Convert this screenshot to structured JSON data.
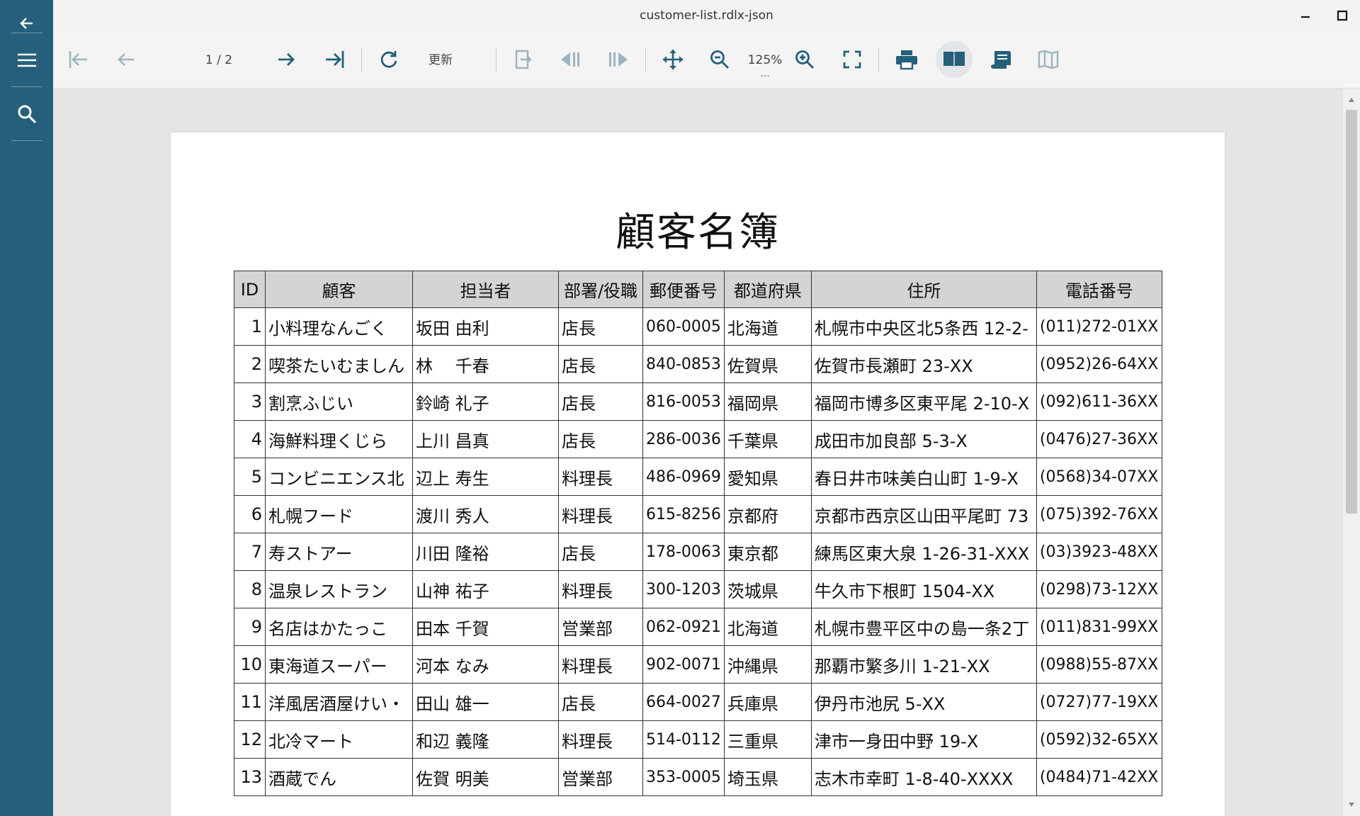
{
  "window": {
    "title": "customer-list.rdlx-json"
  },
  "toolbar": {
    "page_indicator": "1 / 2",
    "refresh_label": "更新",
    "zoom_level": "125%",
    "zoom_more": "..."
  },
  "report": {
    "title": "顧客名簿",
    "columns": [
      "ID",
      "顧客",
      "担当者",
      "部署/役職",
      "郵便番号",
      "都道府県",
      "住所",
      "電話番号"
    ],
    "rows": [
      [
        "1",
        "小料理なんごく",
        "坂田 由利",
        "店長",
        "060-0005",
        "北海道",
        "札幌市中央区北5条西 12-2-",
        "(011)272-01XX"
      ],
      [
        "2",
        "喫茶たいむましん",
        "林　 千春",
        "店長",
        "840-0853",
        "佐賀県",
        "佐賀市長瀬町 23-XX",
        "(0952)26-64XX"
      ],
      [
        "3",
        "割烹ふじい",
        "鈴崎 礼子",
        "店長",
        "816-0053",
        "福岡県",
        "福岡市博多区東平尾 2-10-X",
        "(092)611-36XX"
      ],
      [
        "4",
        "海鮮料理くじら",
        "上川 昌真",
        "店長",
        "286-0036",
        "千葉県",
        "成田市加良部 5-3-X",
        "(0476)27-36XX"
      ],
      [
        "5",
        "コンビニエンス北",
        "辺上 寿生",
        "料理長",
        "486-0969",
        "愛知県",
        "春日井市味美白山町 1-9-X",
        "(0568)34-07XX"
      ],
      [
        "6",
        "札幌フード",
        "渡川 秀人",
        "料理長",
        "615-8256",
        "京都府",
        "京都市西京区山田平尾町 73",
        "(075)392-76XX"
      ],
      [
        "7",
        "寿ストアー",
        "川田 隆裕",
        "店長",
        "178-0063",
        "東京都",
        "練馬区東大泉 1-26-31-XXX",
        "(03)3923-48XX"
      ],
      [
        "8",
        "温泉レストラン",
        "山神 祐子",
        "料理長",
        "300-1203",
        "茨城県",
        "牛久市下根町 1504-XX",
        "(0298)73-12XX"
      ],
      [
        "9",
        "名店はかたっこ",
        "田本 千賀",
        "営業部",
        "062-0921",
        "北海道",
        "札幌市豊平区中の島一条2丁",
        "(011)831-99XX"
      ],
      [
        "10",
        "東海道スーパー",
        "河本 なみ",
        "料理長",
        "902-0071",
        "沖縄県",
        "那覇市繁多川 1-21-XX",
        "(0988)55-87XX"
      ],
      [
        "11",
        "洋風居酒屋けい・",
        "田山 雄一",
        "店長",
        "664-0027",
        "兵庫県",
        "伊丹市池尻 5-XX",
        "(0727)77-19XX"
      ],
      [
        "12",
        "北冷マート",
        "和辺 義隆",
        "料理長",
        "514-0112",
        "三重県",
        "津市一身田中野 19-X",
        "(0592)32-65XX"
      ],
      [
        "13",
        "酒蔵でん",
        "佐賀 明美",
        "営業部",
        "353-0005",
        "埼玉県",
        "志木市幸町 1-8-40-XXXX",
        "(0484)71-42XX"
      ]
    ]
  },
  "colors": {
    "rail": "#255f7b",
    "toolbar_bg": "#f4f4f4",
    "icon_primary": "#255f7b",
    "icon_disabled": "#9db4c0",
    "header_fill": "#d4d4d4"
  }
}
